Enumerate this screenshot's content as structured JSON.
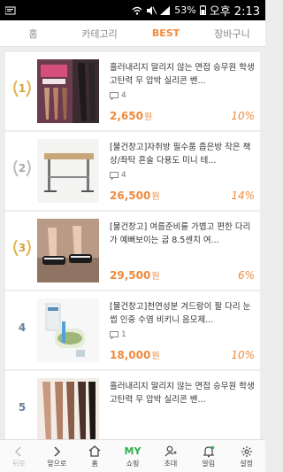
{
  "status": {
    "battery": "53%",
    "time": "오후 2:13"
  },
  "tabs": [
    {
      "label": "홈"
    },
    {
      "label": "카테고리"
    },
    {
      "label": "BEST"
    },
    {
      "label": "장바구니"
    }
  ],
  "items": [
    {
      "rank": "1",
      "title": "흘러내리지 말리지 않는 면접 승무원 학생 고탄력 무 압박 실리콘 밴...",
      "comments": "4",
      "price": "2,650",
      "won": "원",
      "discount": "10%"
    },
    {
      "rank": "2",
      "title": "[물건창고]자취방 필수품 좁은방 작은 책상/좌탁 혼술 다용도 미니 테...",
      "comments": "4",
      "price": "26,500",
      "won": "원",
      "discount": "14%"
    },
    {
      "rank": "3",
      "title": "[물건창고] 여름준비를 가볍고 편한 다리가 예뻐보이는 굽 8.5센치 여...",
      "comments": "",
      "price": "29,500",
      "won": "원",
      "discount": "6%"
    },
    {
      "rank": "4",
      "title": "[물건창고]천연성분 겨드랑이 팔 다리 눈썹 인중 수염 비키니 음모제...",
      "comments": "1",
      "price": "18,000",
      "won": "원",
      "discount": "10%"
    },
    {
      "rank": "5",
      "title": "흘러내리지 말리지 않는 면접 승무원 학생 고탄력 무 압박 실리콘 밴...",
      "comments": "",
      "price": "",
      "won": "",
      "discount": ""
    }
  ],
  "nav": [
    {
      "label": "뒤로"
    },
    {
      "label": "앞으로"
    },
    {
      "label": "홈"
    },
    {
      "icon_text": "MY",
      "label": "쇼핑"
    },
    {
      "label": "초대"
    },
    {
      "label": "알림"
    },
    {
      "label": "설정"
    }
  ]
}
